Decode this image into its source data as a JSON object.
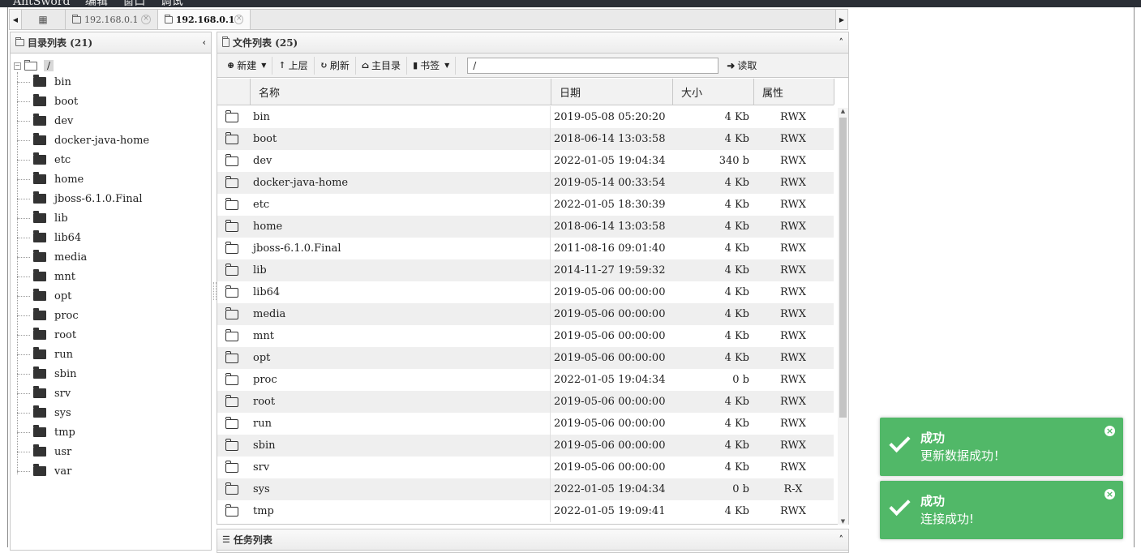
{
  "app": {
    "menu": [
      "AntSword",
      "编辑",
      "窗口",
      "调试"
    ]
  },
  "tabs": [
    {
      "label": "192.168.0.1",
      "active": false
    },
    {
      "label": "192.168.0.1",
      "active": true
    }
  ],
  "dir_panel": {
    "title": "目录列表 (21)",
    "root": "/",
    "items": [
      "bin",
      "boot",
      "dev",
      "docker-java-home",
      "etc",
      "home",
      "jboss-6.1.0.Final",
      "lib",
      "lib64",
      "media",
      "mnt",
      "opt",
      "proc",
      "root",
      "run",
      "sbin",
      "srv",
      "sys",
      "tmp",
      "usr",
      "var"
    ]
  },
  "file_panel": {
    "title": "文件列表 (25)",
    "toolbar": {
      "new": "新建",
      "up": "上层",
      "refresh": "刷新",
      "home": "主目录",
      "bookmark": "书签",
      "path": "/",
      "read": "读取"
    },
    "columns": [
      "名称",
      "日期",
      "大小",
      "属性"
    ],
    "rows": [
      {
        "name": "bin",
        "date": "2019-05-08 05:20:20",
        "size": "4 Kb",
        "attr": "RWX"
      },
      {
        "name": "boot",
        "date": "2018-06-14 13:03:58",
        "size": "4 Kb",
        "attr": "RWX"
      },
      {
        "name": "dev",
        "date": "2022-01-05 19:04:34",
        "size": "340 b",
        "attr": "RWX"
      },
      {
        "name": "docker-java-home",
        "date": "2019-05-14 00:33:54",
        "size": "4 Kb",
        "attr": "RWX"
      },
      {
        "name": "etc",
        "date": "2022-01-05 18:30:39",
        "size": "4 Kb",
        "attr": "RWX"
      },
      {
        "name": "home",
        "date": "2018-06-14 13:03:58",
        "size": "4 Kb",
        "attr": "RWX"
      },
      {
        "name": "jboss-6.1.0.Final",
        "date": "2011-08-16 09:01:40",
        "size": "4 Kb",
        "attr": "RWX"
      },
      {
        "name": "lib",
        "date": "2014-11-27 19:59:32",
        "size": "4 Kb",
        "attr": "RWX"
      },
      {
        "name": "lib64",
        "date": "2019-05-06 00:00:00",
        "size": "4 Kb",
        "attr": "RWX"
      },
      {
        "name": "media",
        "date": "2019-05-06 00:00:00",
        "size": "4 Kb",
        "attr": "RWX"
      },
      {
        "name": "mnt",
        "date": "2019-05-06 00:00:00",
        "size": "4 Kb",
        "attr": "RWX"
      },
      {
        "name": "opt",
        "date": "2019-05-06 00:00:00",
        "size": "4 Kb",
        "attr": "RWX"
      },
      {
        "name": "proc",
        "date": "2022-01-05 19:04:34",
        "size": "0 b",
        "attr": "RWX"
      },
      {
        "name": "root",
        "date": "2019-05-06 00:00:00",
        "size": "4 Kb",
        "attr": "RWX"
      },
      {
        "name": "run",
        "date": "2019-05-06 00:00:00",
        "size": "4 Kb",
        "attr": "RWX"
      },
      {
        "name": "sbin",
        "date": "2019-05-06 00:00:00",
        "size": "4 Kb",
        "attr": "RWX"
      },
      {
        "name": "srv",
        "date": "2019-05-06 00:00:00",
        "size": "4 Kb",
        "attr": "RWX"
      },
      {
        "name": "sys",
        "date": "2022-01-05 19:04:34",
        "size": "0 b",
        "attr": "R-X"
      },
      {
        "name": "tmp",
        "date": "2022-01-05 19:09:41",
        "size": "4 Kb",
        "attr": "RWX"
      }
    ]
  },
  "task_panel": {
    "title": "任务列表"
  },
  "notifications": [
    {
      "title": "成功",
      "message": "更新数据成功！"
    },
    {
      "title": "成功",
      "message": "连接成功!"
    }
  ],
  "colors": {
    "toast_success": "#51b868",
    "topbar": "#2b2f36"
  }
}
